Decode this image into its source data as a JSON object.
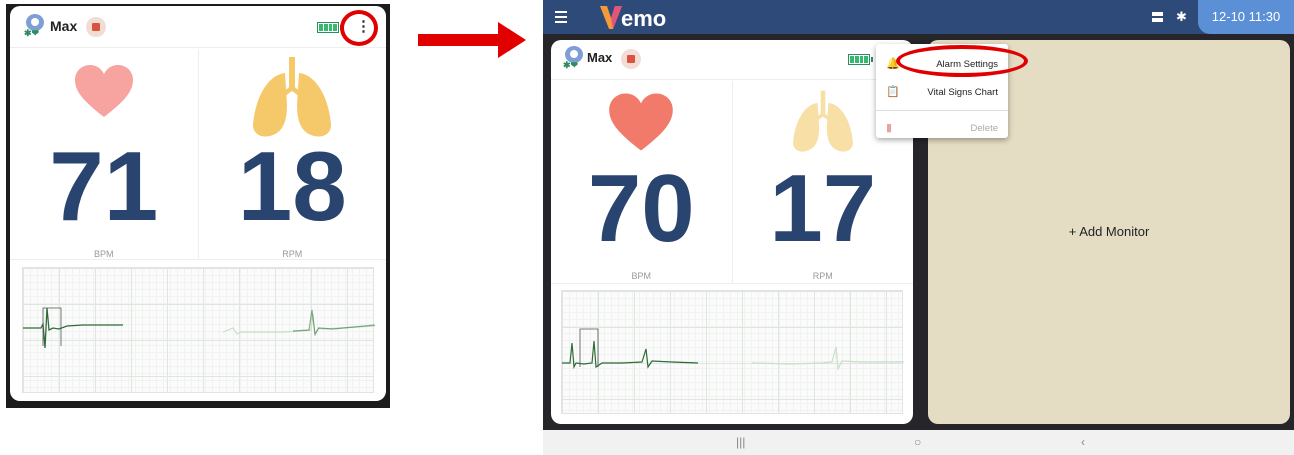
{
  "left": {
    "pet_name": "Max",
    "heart_rate": "71",
    "heart_unit": "BPM",
    "resp_rate": "18",
    "resp_unit": "RPM"
  },
  "right": {
    "app_title": "emo",
    "datetime": "12-10 11:30",
    "pet_name": "Max",
    "heart_rate": "70",
    "heart_unit": "BPM",
    "resp_rate": "17",
    "resp_unit": "RPM",
    "menu": {
      "items": [
        {
          "label": "Alarm Settings",
          "icon": "alarm-bell-icon"
        },
        {
          "label": "Vital Signs Chart",
          "icon": "clipboard-heart-icon"
        },
        {
          "label": "Delete",
          "icon": "trash-icon",
          "disabled": true
        }
      ]
    },
    "add_monitor_label": "+ Add Monitor"
  },
  "colors": {
    "topbar": "#2d4a78",
    "vital_number": "#2a4470",
    "heart_left": "#f7a3a0",
    "heart_right": "#f27a6b",
    "lungs_left": "#f5c86a",
    "lungs_right": "#f8dfa6",
    "highlight_circle": "#e00000",
    "add_monitor_bg": "#e4dcc3",
    "ecg_trace": "#2e6b3a"
  }
}
